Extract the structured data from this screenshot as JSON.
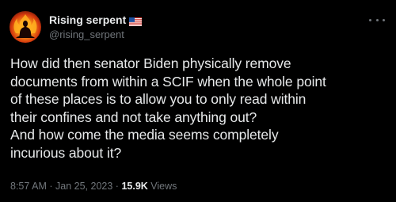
{
  "author": {
    "display_name": "Rising serpent",
    "handle": "@rising_serpent",
    "verified_flag": "us-flag-emoji",
    "avatar_icon": "serpent-fire-avatar"
  },
  "menu": {
    "icon": "more-horizontal-icon"
  },
  "tweet": {
    "text": "How did then senator Biden physically remove\ndocuments from within a SCIF when the whole point\nof these places is to allow you to only read within\ntheir confines and not take anything out?\nAnd how come the media seems completely\nincurious about it?"
  },
  "meta": {
    "time": "8:57 AM",
    "separator": "·",
    "date": "Jan 25, 2023",
    "views_count": "15.9K",
    "views_label": "Views"
  },
  "colors": {
    "background": "#000000",
    "primary_text": "#e7e9ea",
    "secondary_text": "#71767b"
  }
}
